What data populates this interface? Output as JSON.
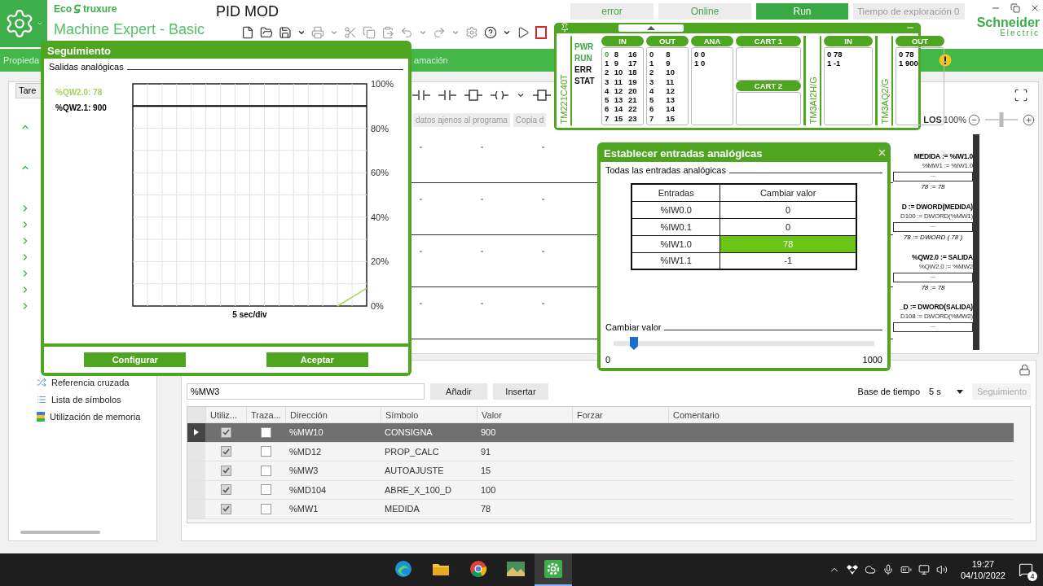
{
  "header": {
    "brand_prefix": "Eco",
    "brand_suffix": "truxure",
    "product": "Machine Expert - Basic",
    "project": "PID MOD",
    "vendor": "Schneider",
    "vendor_line2": "Electric",
    "status": [
      {
        "kind": "button",
        "label": "error",
        "selected": false
      },
      {
        "kind": "button",
        "label": "Online",
        "selected": false
      },
      {
        "kind": "button",
        "label": "Run",
        "selected": true
      },
      {
        "kind": "field",
        "label": "Tiempo de exploración 0"
      }
    ]
  },
  "nav_bar": {
    "tabs": [
      {
        "label": "Propieda"
      },
      {
        "label": "amación"
      }
    ]
  },
  "left_panel": {
    "tab": "Tare",
    "tree": [
      {
        "expanded": true
      },
      {
        "expanded": true
      },
      {
        "expanded": false
      },
      {
        "expanded": false
      },
      {
        "expanded": false
      },
      {
        "expanded": false
      },
      {
        "expanded": false
      },
      {
        "expanded": false
      },
      {
        "expanded": false
      }
    ],
    "links": [
      {
        "kind": "crossref",
        "label": "Referencia cruzada"
      },
      {
        "kind": "symbols",
        "label": "Lista de símbolos"
      },
      {
        "kind": "memory",
        "label": "Utilización de memoria"
      }
    ]
  },
  "editor": {
    "filters": [
      "datos ajenos al programa",
      "Copia d"
    ],
    "zoom_prefix": "LOS",
    "zoom": {
      "label": "100%",
      "level": 0.5
    },
    "rungs": [
      {
        "assignment": "MEDIDA := %IW1.0",
        "expression": "%MW1 := %IW1.0",
        "block": "...",
        "result": "78 := 78"
      },
      {
        "assignment": "D := DWORD(MEDIDA)",
        "expression": "D100 := DWORD(%MW1)",
        "block": "...",
        "result": "78 := DWORD ( 78 )"
      },
      {
        "assignment": "%QW2.0 := SALIDA",
        "expression": "%QW2.0 := %MW2",
        "block": "...",
        "result": "78 := 78"
      },
      {
        "assignment": "_D := DWORD(SALIDA)",
        "expression": "D108 := DWORD(%MW2)",
        "block": "..."
      }
    ]
  },
  "monitor_table": {
    "address": "%MW3",
    "buttons": [
      "Añadir",
      "Insertar"
    ],
    "time_base_label": "Base de tiempo",
    "time_base": "5 s",
    "trace_button": {
      "label": "Seguimiento",
      "disabled": true
    },
    "columns": [
      "Utiliz...",
      "Traza...",
      "Dirección",
      "Símbolo",
      "Valor",
      "Forzar",
      "Comentario"
    ],
    "rows": [
      {
        "used": true,
        "traced": false,
        "address": "%MW10",
        "symbol": "CONSIGNA",
        "value": "900",
        "selected": true
      },
      {
        "used": true,
        "traced": false,
        "address": "%MD12",
        "symbol": "PROP_CALC",
        "value": "91",
        "selected": false
      },
      {
        "used": true,
        "traced": false,
        "address": "%MW3",
        "symbol": "AUTOAJUSTE",
        "value": "15",
        "selected": false
      },
      {
        "used": true,
        "traced": false,
        "address": "%MD104",
        "symbol": "ABRE_X_100_D",
        "value": "100",
        "selected": false
      },
      {
        "used": true,
        "traced": false,
        "address": "%MW1",
        "symbol": "MEDIDA",
        "value": "78",
        "selected": false
      }
    ]
  },
  "trace_window": {
    "title": "Seguimiento",
    "section": "Salidas analógicas",
    "chart_data": {
      "type": "line",
      "grid": true,
      "xlabel": "5 sec/div",
      "ylim": [
        0,
        100
      ],
      "yticks": [
        {
          "value": 0,
          "label": "0%"
        },
        {
          "value": 20,
          "label": "20%"
        },
        {
          "value": 40,
          "label": "40%"
        },
        {
          "value": 60,
          "label": "60%"
        },
        {
          "value": 80,
          "label": "80%"
        },
        {
          "value": 100,
          "label": "100%"
        }
      ],
      "series": [
        {
          "name": "%QW2.0: 78",
          "color": "#a8d25c",
          "values": [
            null,
            null,
            null,
            null,
            null,
            null,
            null,
            null,
            null,
            null,
            null,
            null,
            null,
            null,
            0,
            4,
            8
          ]
        },
        {
          "name": "%QW2.1: 900",
          "color": "#000000",
          "values": [
            90,
            90,
            90,
            90,
            90,
            90,
            90,
            90,
            90,
            90,
            90,
            90,
            90,
            90,
            90,
            90,
            90
          ]
        }
      ]
    },
    "buttons": [
      "Configurar",
      "Aceptar"
    ]
  },
  "plc_panel": {
    "modules": [
      {
        "name": "TM221C40T",
        "leds": [
          {
            "label": "PWR",
            "on": true
          },
          {
            "label": "RUN",
            "on": true
          },
          {
            "label": "ERR",
            "on": false
          },
          {
            "label": "STAT",
            "on": false
          }
        ],
        "groups": [
          {
            "kind": "bits",
            "title": "IN",
            "bits": [
              {
                "label": "0",
                "on": true
              },
              {
                "label": "1",
                "on": false
              },
              {
                "label": "2",
                "on": false
              },
              {
                "label": "3",
                "on": false
              },
              {
                "label": "4",
                "on": false
              },
              {
                "label": "5",
                "on": false
              },
              {
                "label": "6",
                "on": false
              },
              {
                "label": "7",
                "on": false
              },
              {
                "label": "8",
                "on": false
              },
              {
                "label": "9",
                "on": false
              },
              {
                "label": "10",
                "on": false
              },
              {
                "label": "11",
                "on": false
              },
              {
                "label": "12",
                "on": false
              },
              {
                "label": "13",
                "on": false
              },
              {
                "label": "14",
                "on": false
              },
              {
                "label": "15",
                "on": false
              },
              {
                "label": "16",
                "on": false
              },
              {
                "label": "17",
                "on": false
              },
              {
                "label": "18",
                "on": false
              },
              {
                "label": "19",
                "on": false
              },
              {
                "label": "20",
                "on": false
              },
              {
                "label": "21",
                "on": false
              },
              {
                "label": "22",
                "on": false
              },
              {
                "label": "23",
                "on": false
              }
            ]
          },
          {
            "kind": "bits",
            "title": "OUT",
            "bits": [
              {
                "label": "0",
                "on": false
              },
              {
                "label": "1",
                "on": false
              },
              {
                "label": "2",
                "on": false
              },
              {
                "label": "3",
                "on": false
              },
              {
                "label": "4",
                "on": false
              },
              {
                "label": "5",
                "on": false
              },
              {
                "label": "6",
                "on": false
              },
              {
                "label": "7",
                "on": false
              },
              {
                "label": "8",
                "on": false
              },
              {
                "label": "9",
                "on": false
              },
              {
                "label": "10",
                "on": false
              },
              {
                "label": "11",
                "on": false
              },
              {
                "label": "12",
                "on": false
              },
              {
                "label": "13",
                "on": false
              },
              {
                "label": "14",
                "on": false
              },
              {
                "label": "15",
                "on": false
              }
            ]
          },
          {
            "kind": "values",
            "title": "ANA",
            "values": [
              "0 0",
              "1 0"
            ]
          },
          {
            "kind": "cartridges",
            "titles": [
              "CART 1",
              "CART 2"
            ]
          }
        ]
      },
      {
        "name": "TM3AI2H/G",
        "groups": [
          {
            "kind": "values",
            "title": "IN",
            "values": [
              "0 78",
              "1 -1"
            ]
          }
        ]
      },
      {
        "name": "TM3AQ2/G",
        "groups": [
          {
            "kind": "values",
            "title": "OUT",
            "values": [
              "0 78",
              "1 900"
            ]
          }
        ]
      }
    ]
  },
  "set_inputs": {
    "title": "Establecer entradas analógicas",
    "section": "Todas las entradas analógicas",
    "columns": [
      "Entradas",
      "Cambiar valor"
    ],
    "rows": [
      {
        "input": "%IW0.0",
        "value": "0",
        "selected": false
      },
      {
        "input": "%IW0.1",
        "value": "0",
        "selected": false
      },
      {
        "input": "%IW1.0",
        "value": "78",
        "selected": true
      },
      {
        "input": "%IW1.1",
        "value": "-1",
        "selected": false
      }
    ],
    "slider_label": "Cambiar valor",
    "slider": {
      "level": 0.078
    },
    "min": "0",
    "max": "1000"
  },
  "taskbar": {
    "apps": [
      {
        "kind": "edge",
        "active": false
      },
      {
        "kind": "folder",
        "active": false
      },
      {
        "kind": "chrome",
        "active": false
      },
      {
        "kind": "photos",
        "active": false
      },
      {
        "kind": "gear",
        "active": true
      }
    ],
    "time": "19:27",
    "date": "04/10/2022",
    "notifications": "4"
  }
}
